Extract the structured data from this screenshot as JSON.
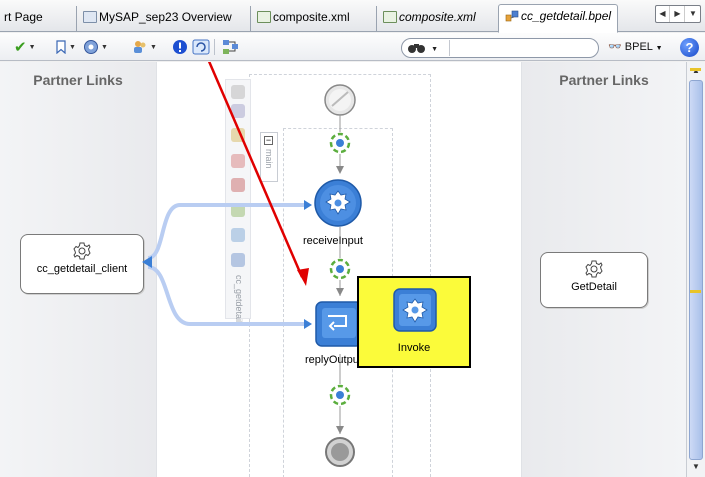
{
  "tabs": [
    {
      "label": "rt Page",
      "italic": false
    },
    {
      "label": "MySAP_sep23 Overview",
      "italic": false
    },
    {
      "label": "composite.xml",
      "italic": false
    },
    {
      "label": "composite.xml",
      "italic": true
    },
    {
      "label": "cc_getdetail.bpel",
      "italic": true,
      "active": true
    }
  ],
  "toolbar": {
    "search_placeholder": "",
    "bpel_label": "BPEL",
    "help_label": "?"
  },
  "canvas": {
    "left_panel_title": "Partner Links",
    "right_panel_title": "Partner Links",
    "left_partner": "cc_getdetail_client",
    "right_partner": "GetDetail",
    "receive_label": "receiveInput",
    "reply_label": "replyOutput",
    "scope_label": "cc_getdetail",
    "main_tab_label": "main",
    "tooltip_label": "Invoke"
  },
  "colors": {
    "annotation_arrow": "#e00000",
    "tooltip_bg": "#fbfb3a",
    "activity_blue": "#3b7fd6",
    "link_line": "#b9cdf2"
  }
}
